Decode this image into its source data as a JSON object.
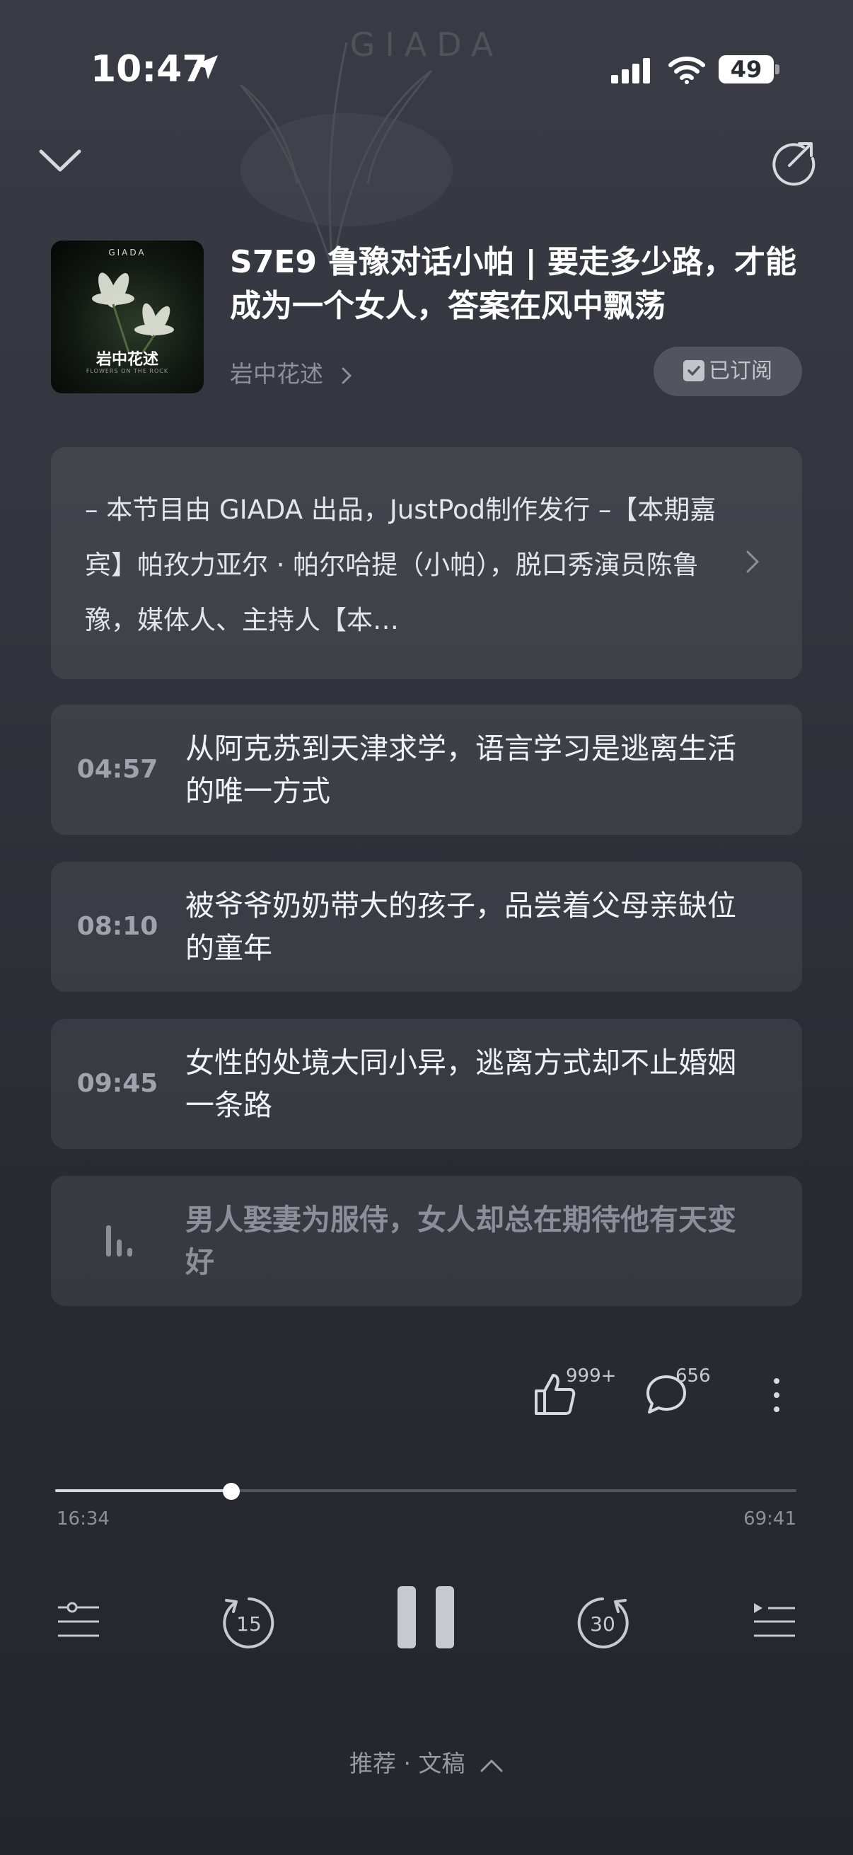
{
  "status_bar": {
    "time": "10:47",
    "battery": "49",
    "icons": [
      "location-arrow-icon",
      "signal-icon",
      "wifi-icon",
      "battery-icon"
    ]
  },
  "background": {
    "brand": "GIADA"
  },
  "header": {
    "cover": {
      "brand": "GIADA",
      "title": "岩中花述",
      "subtitle": "FLOWERS ON THE ROCK"
    },
    "episode_title": "S7E9 鲁豫对话小帕 | 要走多少路，才能成为一个女人，答案在风中飘荡",
    "show_name": "岩中花述",
    "subscribed_label": "已订阅"
  },
  "description": {
    "text": "– 本节目由 GIADA 出品，JustPod制作发行 –【本期嘉宾】帕孜力亚尔 · 帕尔哈提（小帕），脱口秀演员陈鲁豫，媒体人、主持人【本…"
  },
  "chapters": [
    {
      "time": "04:57",
      "title": "从阿克苏到天津求学，语言学习是逃离生活的唯一方式"
    },
    {
      "time": "08:10",
      "title": "被爷爷奶奶带大的孩子，品尝着父母亲缺位的童年"
    },
    {
      "time": "09:45",
      "title": "女性的处境大同小异，逃离方式却不止婚姻一条路"
    },
    {
      "time": "",
      "title": "男人娶妻为服侍，女人却总在期待他有天变好",
      "playing": true
    }
  ],
  "actions": {
    "likes": "999+",
    "comments": "656"
  },
  "player": {
    "elapsed": "16:34",
    "total": "69:41",
    "progress_fraction": 0.2377,
    "rewind_seconds": "15",
    "forward_seconds": "30"
  },
  "bottom": {
    "tabs_label": "推荐 · 文稿"
  },
  "colors": {
    "background": "#34343e",
    "card": "#3f3f49",
    "text_muted": "#8f8f9a"
  }
}
